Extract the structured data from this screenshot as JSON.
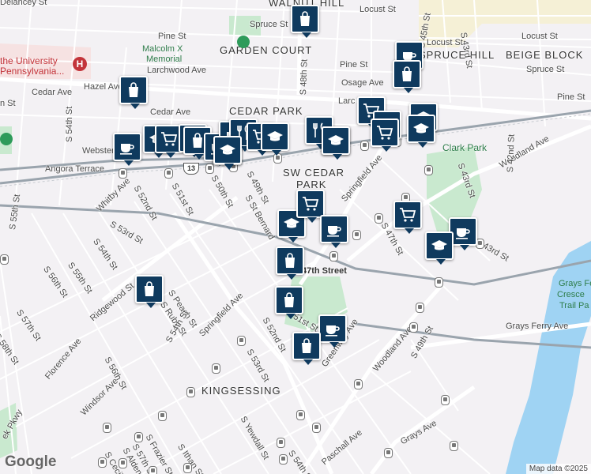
{
  "map": {
    "neighborhoods": {
      "walnut_hill": "WALNUT HILL",
      "garden_court": "GARDEN COURT",
      "spruce_hill": "SPRUCE HILL",
      "beige_block": "BEIGE BLOCK",
      "cedar_park": "CEDAR PARK",
      "sw_cedar_park_1": "SW CEDAR",
      "sw_cedar_park_2": "PARK",
      "kingsessing": "KINGSESSING"
    },
    "streets": {
      "locust_top": "Locust St",
      "spruce": "Spruce St",
      "pine_left": "Pine St",
      "larchwood": "Larchwood Ave",
      "hazel": "Hazel Ave",
      "cedar": "Cedar Ave",
      "cedar_2": "Cedar Ave",
      "webster": "Webster St",
      "angora": "Angora Terrace",
      "s_54th_top": "S 54th St",
      "s_55th_left": "S 55th St",
      "whitby": "Whitby Ave",
      "s_52nd_a": "S 52nd St",
      "s_51st_a": "S 51st St",
      "s_50th_a": "S 50th St",
      "s_49th_a": "S 49th St",
      "s_48th": "S 48th St",
      "s_st_bernard": "S St Bernard",
      "s_53rd_a": "S 53rd St",
      "s_54th_a": "S 54th St",
      "s_55th_a": "S 55th St",
      "s_56th_a": "S 56th St",
      "s_57th_a": "S 57th St",
      "s_58th_a": "S 58th St",
      "ridgewood": "Ridgewood St",
      "peach": "S Peach St",
      "ruby": "S Ruby St",
      "s_54th_b": "S 54th St",
      "florence": "Florence Ave",
      "springfield_a": "Springfield Ave",
      "springfield_b": "Springfield Ave",
      "s_52nd_b": "S 52nd St",
      "s_51st_b": "51st St",
      "s_53rd_b": "S 53rd St",
      "windsor": "Windsor Ave",
      "s_56th_b": "S 56th St",
      "greenway": "Greenway Ave",
      "woodland_a": "Woodland Ave",
      "woodland_b": "Woodland Ave",
      "s_49th_b": "S 49th St",
      "s_47th": "S 47th St",
      "s_43rd_a": "S 43rd St",
      "s_43rd_b": "S 43rd St",
      "s_43rd_c": "S 43rd St",
      "s_42nd": "S 42nd St",
      "s_45th": "S 45th St",
      "locust_right": "Locust St",
      "locust_mid": "Locust St",
      "pine_mid": "Pine St",
      "pine_right": "Pine St",
      "osage": "Osage Ave",
      "spruce_right": "Spruce St",
      "grays_ferry": "Grays Ferry Ave",
      "grays_ave": "Grays Ave",
      "paschall": "Paschall Ave",
      "s_yewdall": "S Yewdall St",
      "s_ithan": "S Ithan St",
      "s_frazier": "S Frazier St",
      "s_57th_b": "S 57th St",
      "s_alden": "S Alden St",
      "s_cecil": "S Cecil St",
      "s_54th_c": "S 54th St",
      "station_47th": "47th Street",
      "larchwood_mid": "Larc",
      "elmwood_left": "Cedar Ave",
      "bk_pkwy": "ek Pkwy",
      "s_43rd_top": "S 43rd St",
      "delancey": "Delancey St",
      "n_5": "n St",
      "s_53rd_c": "S 53rd St"
    },
    "pois": {
      "malcolm_x_1": "Malcolm X",
      "malcolm_x_2": "Memorial",
      "upenn_1": "the University",
      "upenn_2": "Pennsylvania...",
      "clark_park": "Clark Park",
      "grays_ferry_1": "Grays Fe",
      "grays_ferry_2": "Cresce",
      "grays_ferry_3": "Trail Pa"
    },
    "highway_shield": "13",
    "google_logo": "Google",
    "attribution": "Map data ©2025"
  },
  "colors": {
    "marker": "#0f3a5e",
    "water": "#9fd3f3",
    "park": "#c9e9cf",
    "rail": "#9aa4ad",
    "road_major": "#ffffff",
    "background": "#f3f1f4"
  },
  "markers": [
    {
      "type": "shopping-bag"
    },
    {
      "type": "coffee"
    },
    {
      "type": "shopping-bag"
    },
    {
      "type": "shopping-bag"
    },
    {
      "type": "school"
    },
    {
      "type": "shopping-cart"
    },
    {
      "type": "coffee"
    },
    {
      "type": "restaurant"
    },
    {
      "type": "school"
    },
    {
      "type": "coffee"
    },
    {
      "type": "shopping-bag"
    },
    {
      "type": "coffee"
    },
    {
      "type": "shopping-bag"
    },
    {
      "type": "coffee"
    },
    {
      "type": "restaurant"
    },
    {
      "type": "shopping-cart"
    },
    {
      "type": "school"
    },
    {
      "type": "shopping-cart"
    },
    {
      "type": "school"
    },
    {
      "type": "school"
    },
    {
      "type": "shopping-cart"
    },
    {
      "type": "school"
    },
    {
      "type": "school"
    },
    {
      "type": "school"
    },
    {
      "type": "shopping-cart"
    },
    {
      "type": "coffee"
    },
    {
      "type": "coffee"
    },
    {
      "type": "school"
    },
    {
      "type": "shopping-cart"
    },
    {
      "type": "shopping-bag"
    }
  ]
}
